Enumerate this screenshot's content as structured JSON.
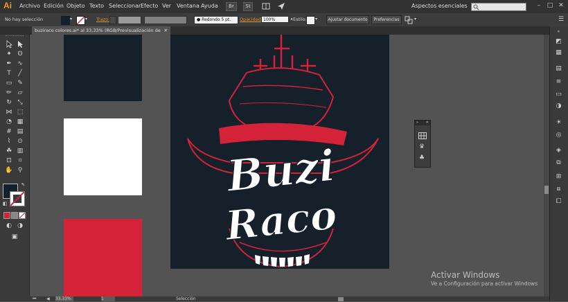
{
  "app": {
    "logo": "Ai"
  },
  "menu": {
    "items": [
      "Archivo",
      "Edición",
      "Objeto",
      "Texto",
      "Seleccionar",
      "Efecto",
      "Ver",
      "Ventana",
      "Ayuda"
    ],
    "br_label": "Br",
    "st_label": "St",
    "workspace": "Aspectos esenciales",
    "window_controls": [
      "–",
      "□",
      "✕"
    ]
  },
  "control_bar": {
    "selection_status": "No hay selección",
    "stroke_label": "Trazo:",
    "stroke_profile": "Redondo 5 pt.",
    "opacity_label": "Opacidad:",
    "opacity_value": "100%",
    "style_label": "Estilo:",
    "adjust_doc_button": "Ajustar documento",
    "preferences_button": "Preferencias"
  },
  "document_tab": {
    "title": "buziraco colores.ai* al 33,33% (RGB/Previsualización de GPU)",
    "close": "✕"
  },
  "artwork": {
    "word_top": "Buzi",
    "word_bottom": "Raco"
  },
  "swatches": [
    {
      "name": "dark",
      "color": "#15202b"
    },
    {
      "name": "white",
      "color": "#ffffff"
    },
    {
      "name": "red",
      "color": "#d42339"
    }
  ],
  "colors": {
    "artboard_bg": "#15202b",
    "accent_red": "#d42339",
    "ui_dark": "#323232",
    "ui_panel": "#3a3a3a"
  },
  "status_bar": {
    "zoom": "33,33%",
    "page": "1",
    "tool": "Selección"
  },
  "watermark": {
    "title": "Activar Windows",
    "subtitle": "Ve a Configuración para activar Windows"
  }
}
